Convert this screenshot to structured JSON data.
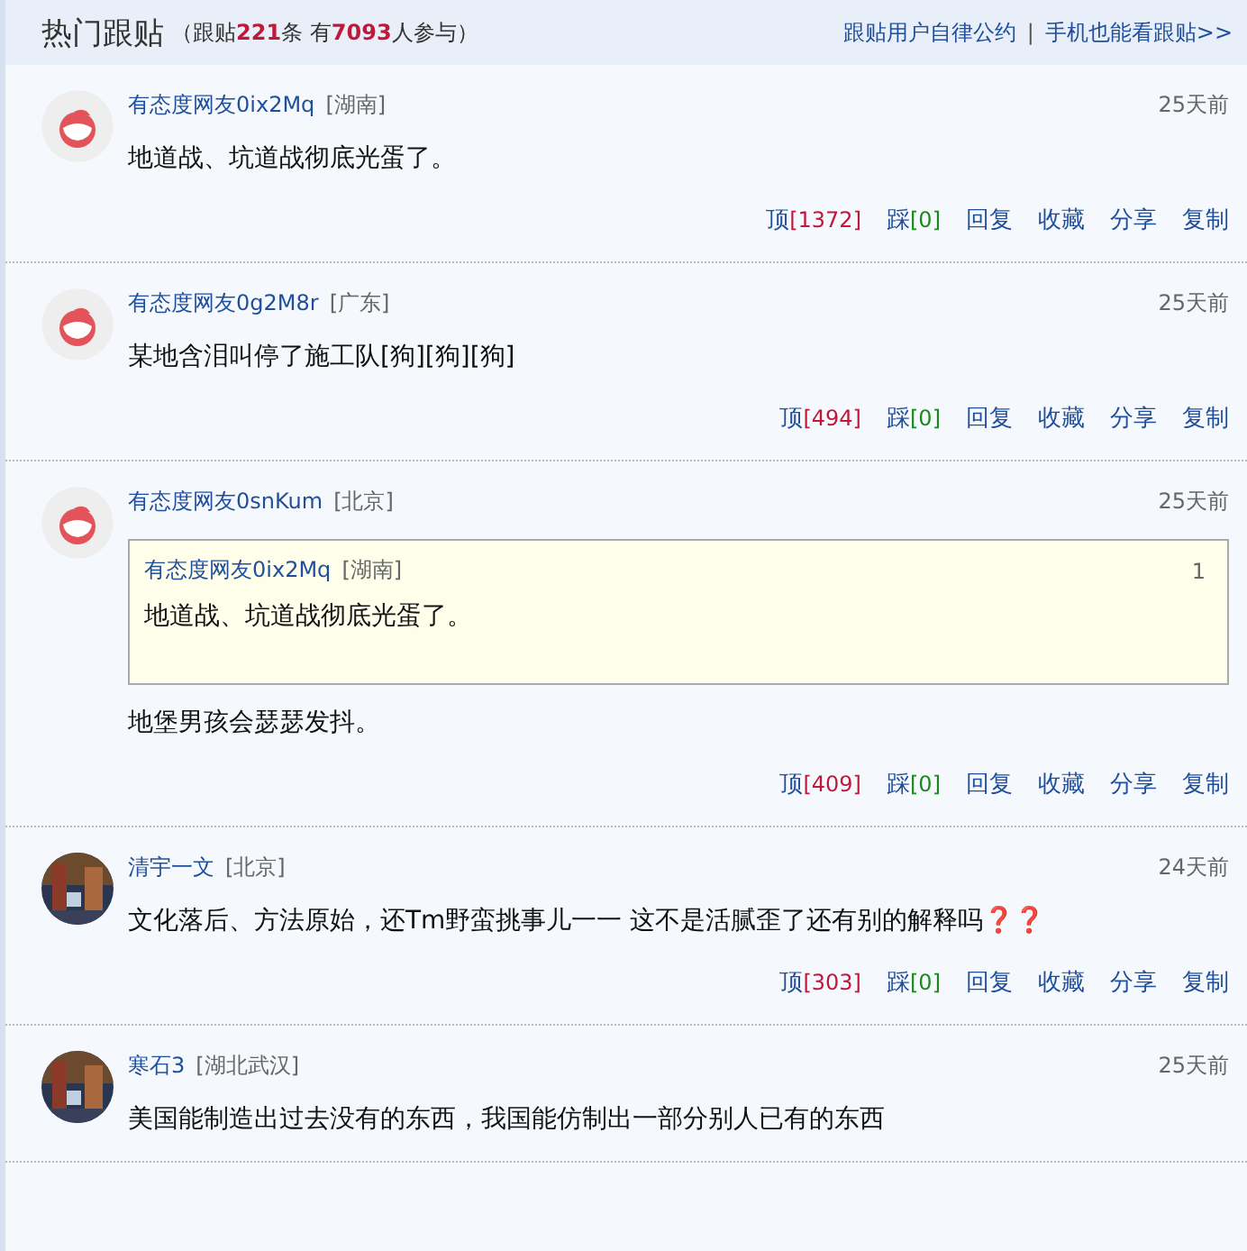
{
  "header": {
    "title": "热门跟贴",
    "stats": [
      {
        "text": "（跟贴",
        "highlight": false
      },
      {
        "text": "221",
        "highlight": true
      },
      {
        "text": "条 有",
        "highlight": false
      },
      {
        "text": "7093",
        "highlight": true
      },
      {
        "text": "人参与）",
        "highlight": false
      }
    ],
    "links": [
      "跟贴用户自律公约",
      "手机也能看跟贴>>"
    ],
    "separator": "|"
  },
  "posts": [
    {
      "avatar": {
        "kind": "logo"
      },
      "author": "有态度网友0ix2Mq",
      "location": "[湖南]",
      "time": "25天前",
      "text": "地道战、坑道战彻底光蛋了。",
      "actions": [
        {
          "kind": "up",
          "label": "顶",
          "count": "[1372]"
        },
        {
          "kind": "down",
          "label": "踩",
          "count": "[0]"
        },
        {
          "kind": "plain",
          "label": "回复"
        },
        {
          "kind": "plain",
          "label": "收藏"
        },
        {
          "kind": "plain",
          "label": "分享"
        },
        {
          "kind": "plain",
          "label": "复制"
        }
      ]
    },
    {
      "avatar": {
        "kind": "logo"
      },
      "author": "有态度网友0g2M8r",
      "location": "[广东]",
      "time": "25天前",
      "text": "某地含泪叫停了施工队[狗][狗][狗]",
      "actions": [
        {
          "kind": "up",
          "label": "顶",
          "count": "[494]"
        },
        {
          "kind": "down",
          "label": "踩",
          "count": "[0]"
        },
        {
          "kind": "plain",
          "label": "回复"
        },
        {
          "kind": "plain",
          "label": "收藏"
        },
        {
          "kind": "plain",
          "label": "分享"
        },
        {
          "kind": "plain",
          "label": "复制"
        }
      ]
    },
    {
      "avatar": {
        "kind": "logo"
      },
      "author": "有态度网友0snKum",
      "location": "[北京]",
      "time": "25天前",
      "quote": {
        "author": "有态度网友0ix2Mq",
        "location": "[湖南]",
        "floor": "1",
        "text": "地道战、坑道战彻底光蛋了。"
      },
      "text": "地堡男孩会瑟瑟发抖。",
      "actions": [
        {
          "kind": "up",
          "label": "顶",
          "count": "[409]"
        },
        {
          "kind": "down",
          "label": "踩",
          "count": "[0]"
        },
        {
          "kind": "plain",
          "label": "回复"
        },
        {
          "kind": "plain",
          "label": "收藏"
        },
        {
          "kind": "plain",
          "label": "分享"
        },
        {
          "kind": "plain",
          "label": "复制"
        }
      ]
    },
    {
      "author": "清宇一文",
      "location": "[北京]",
      "time": "24天前",
      "text": "文化落后、方法原始，还Tm野蛮挑事儿一一 这不是活腻歪了还有别的解释吗❓❓",
      "actions": [
        {
          "kind": "up",
          "label": "顶",
          "count": "[303]"
        },
        {
          "kind": "down",
          "label": "踩",
          "count": "[0]"
        },
        {
          "kind": "plain",
          "label": "回复"
        },
        {
          "kind": "plain",
          "label": "收藏"
        },
        {
          "kind": "plain",
          "label": "分享"
        },
        {
          "kind": "plain",
          "label": "复制"
        }
      ]
    },
    {
      "author": "寒石3",
      "location": "[湖北武汉]",
      "time": "25天前",
      "text": "美国能制造出过去没有的东西，我国能仿制出一部分别人已有的东西"
    }
  ]
}
